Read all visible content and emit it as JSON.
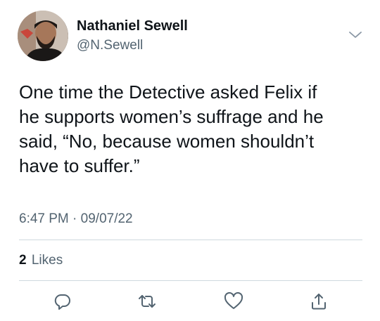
{
  "author": {
    "name": "Nathaniel Sewell",
    "handle": "@N.Sewell"
  },
  "tweet": {
    "text": "One time the Detective asked Felix if\nhe supports women’s suffrage and he\nsaid, “No, because women shouldn’t\nhave to suffer.”",
    "time": "6:47 PM",
    "separator": "·",
    "date": "09/07/22"
  },
  "stats": {
    "likes_count": "2",
    "likes_label": "Likes"
  },
  "icons": {
    "menu": "chevron-down-icon",
    "reply": "reply-icon",
    "retweet": "retweet-icon",
    "like": "heart-icon",
    "share": "share-icon"
  },
  "colors": {
    "text": "#0f1419",
    "secondary": "#536471",
    "divider": "#cfd9de",
    "icon": "#536471"
  }
}
